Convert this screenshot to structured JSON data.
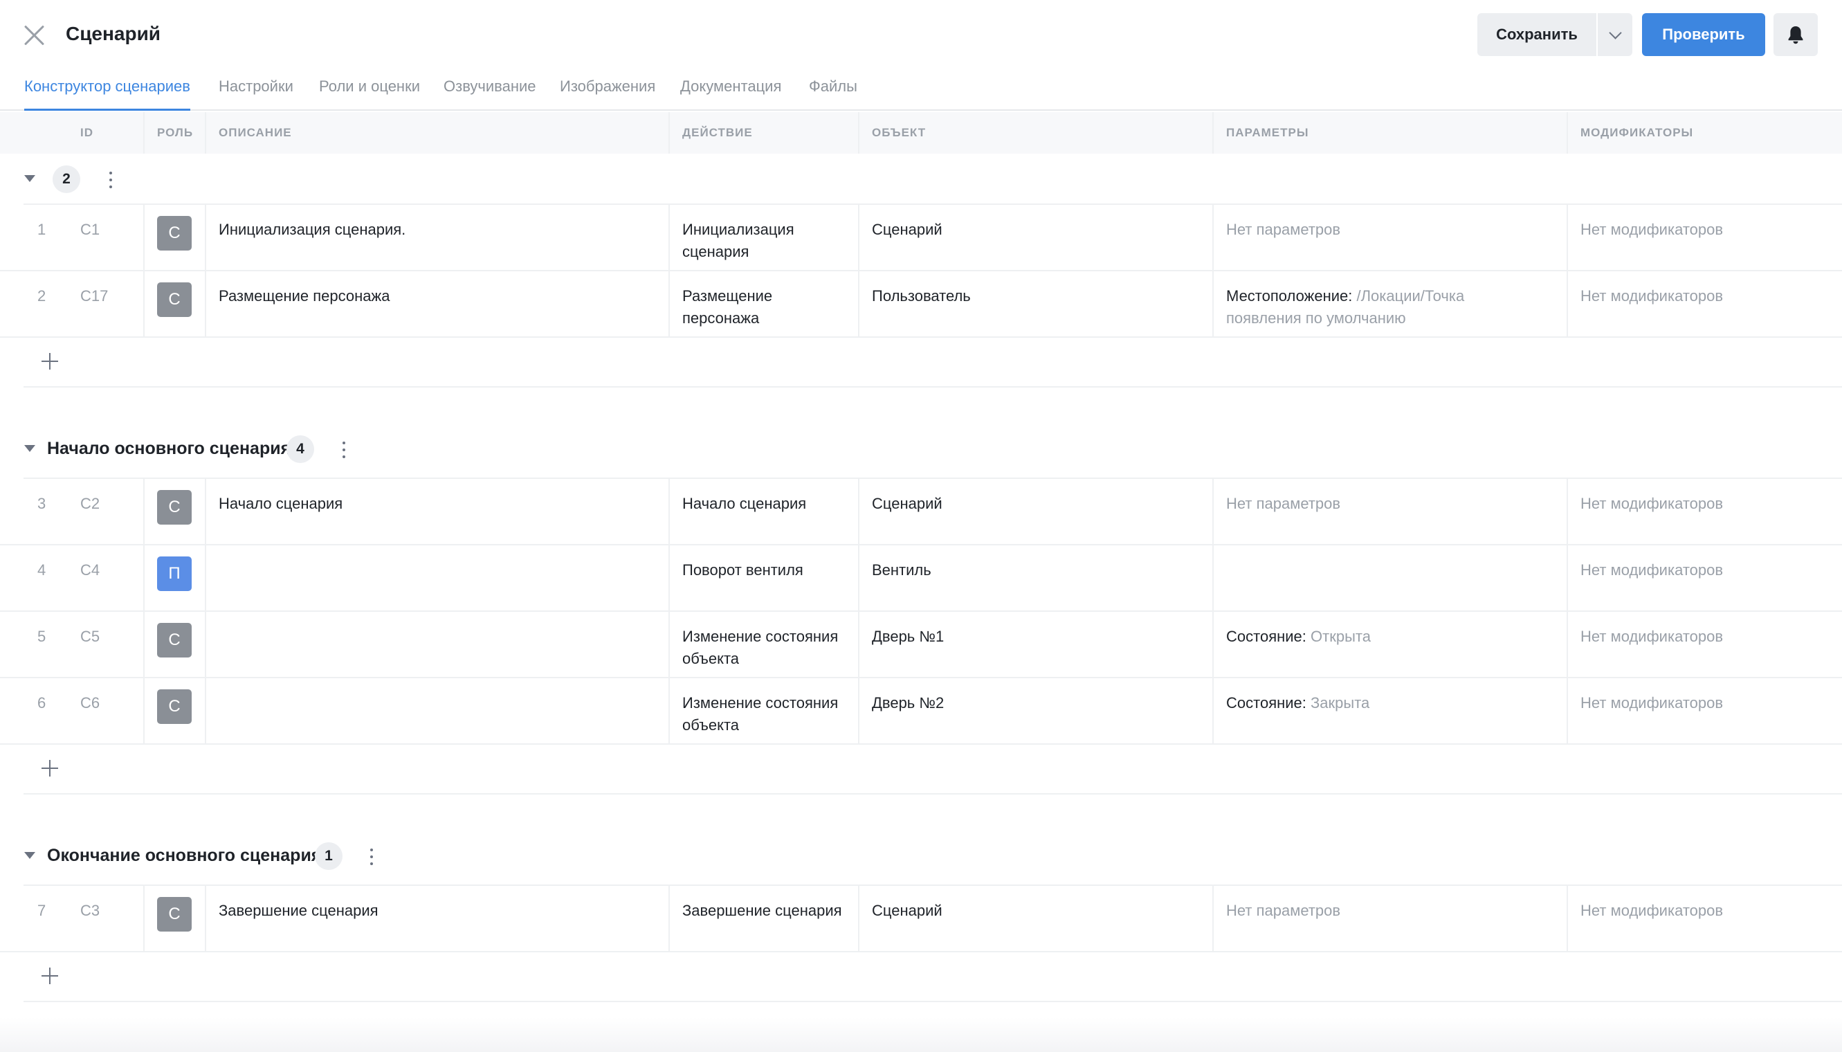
{
  "header": {
    "title": "Сценарий",
    "save_label": "Сохранить",
    "check_label": "Проверить"
  },
  "tabs": [
    {
      "label": "Конструктор сценариев",
      "active": true
    },
    {
      "label": "Настройки"
    },
    {
      "label": "Роли и оценки"
    },
    {
      "label": "Озвучивание"
    },
    {
      "label": "Изображения"
    },
    {
      "label": "Документация"
    },
    {
      "label": "Файлы"
    }
  ],
  "columns": {
    "id": "ID",
    "role": "РОЛЬ",
    "description": "ОПИСАНИЕ",
    "action": "ДЕЙСТВИЕ",
    "object": "ОБЪЕКТ",
    "parameters": "ПАРАМЕТРЫ",
    "modifiers": "МОДИФИКАТОРЫ"
  },
  "groups": [
    {
      "title": "",
      "count": "2",
      "rows": [
        {
          "num": "1",
          "id": "C1",
          "role": "С",
          "description": "Инициализация сценария.",
          "action_l1": "Инициализация",
          "action_l2": "сценария",
          "object": "Сценарий",
          "param_label": "",
          "param_value": "Нет параметров",
          "modifiers": "Нет модификаторов"
        },
        {
          "num": "2",
          "id": "C17",
          "role": "С",
          "description": "Размещение персонажа",
          "action_l1": "Размещение",
          "action_l2": "персонажа",
          "object": "Пользователь",
          "param_label": "Местоположение:",
          "param_value": "/Локации/Точка",
          "param_value_l2": "появления по умолчанию",
          "modifiers": "Нет модификаторов"
        }
      ]
    },
    {
      "title": "Начало основного сценария",
      "count": "4",
      "rows": [
        {
          "num": "3",
          "id": "C2",
          "role": "С",
          "description": "Начало сценария",
          "action_l1": "Начало сценария",
          "object": "Сценарий",
          "param_label": "",
          "param_value": "Нет параметров",
          "modifiers": "Нет модификаторов"
        },
        {
          "num": "4",
          "id": "C4",
          "role": "П",
          "description": "",
          "action_l1": "Поворот вентиля",
          "object": "Вентиль",
          "param_label": "",
          "param_value": "",
          "modifiers": "Нет модификаторов"
        },
        {
          "num": "5",
          "id": "C5",
          "role": "С",
          "description": "",
          "action_l1": "Изменение состояния",
          "action_l2": "объекта",
          "object": "Дверь №1",
          "param_label": "Состояние:",
          "param_value": "Открыта",
          "modifiers": "Нет модификаторов"
        },
        {
          "num": "6",
          "id": "C6",
          "role": "С",
          "description": "",
          "action_l1": "Изменение состояния",
          "action_l2": "объекта",
          "object": "Дверь №2",
          "param_label": "Состояние:",
          "param_value": "Закрыта",
          "modifiers": "Нет модификаторов"
        }
      ]
    },
    {
      "title": "Окончание основного сценария",
      "count": "1",
      "rows": [
        {
          "num": "7",
          "id": "C3",
          "role": "С",
          "description": "Завершение сценария",
          "action_l1": "Завершение сценария",
          "object": "Сценарий",
          "param_label": "",
          "param_value": "Нет параметров",
          "modifiers": "Нет модификаторов"
        }
      ]
    }
  ]
}
